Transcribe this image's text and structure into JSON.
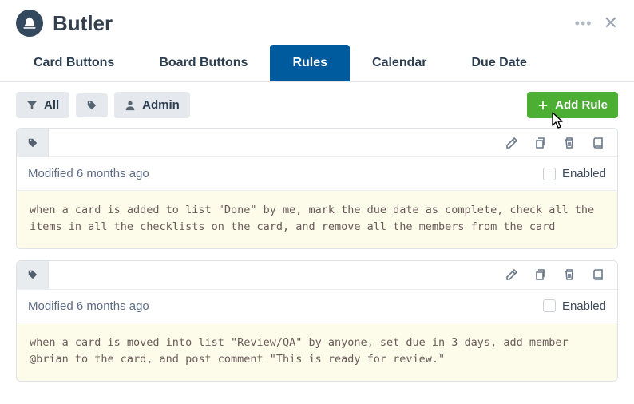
{
  "header": {
    "title": "Butler"
  },
  "tabs": [
    {
      "label": "Card Buttons",
      "active": false
    },
    {
      "label": "Board Buttons",
      "active": false
    },
    {
      "label": "Rules",
      "active": true
    },
    {
      "label": "Calendar",
      "active": false
    },
    {
      "label": "Due Date",
      "active": false
    }
  ],
  "toolbar": {
    "filter_all": "All",
    "filter_admin": "Admin",
    "add_rule": "Add Rule"
  },
  "rules": [
    {
      "modified": "Modified 6 months ago",
      "enabled_label": "Enabled",
      "enabled": false,
      "text": "when a card is added to list \"Done\" by me, mark the due date as complete, check all the items in all the checklists on the card, and remove all the members from the card"
    },
    {
      "modified": "Modified 6 months ago",
      "enabled_label": "Enabled",
      "enabled": false,
      "text": "when a card is moved into list \"Review/QA\" by anyone, set due in 3 days, add member @brian to the card, and post comment \"This is ready for review.\""
    }
  ],
  "colors": {
    "tab_active_bg": "#005a9e",
    "add_button_bg": "#4caf34",
    "rule_body_bg": "#fdfbe9"
  }
}
